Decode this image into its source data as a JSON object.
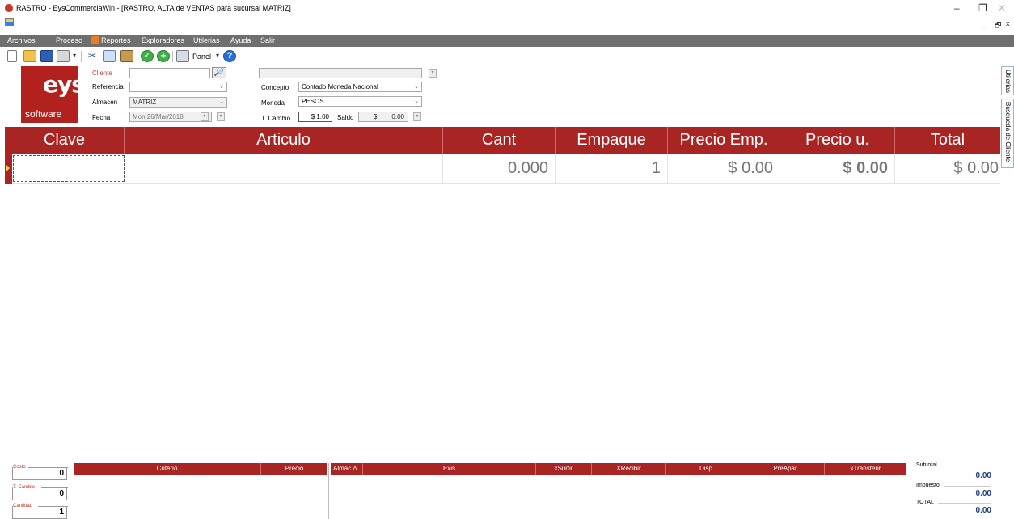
{
  "window": {
    "title": "RASTRO - EysCommerciaWin - [RASTRO, ALTA de VENTAS para sucursal MATRIZ]",
    "minimize": "–",
    "maximize": "❐",
    "close": "✕",
    "mdi_minimize": "_",
    "mdi_restore": "🗗",
    "mdi_close": "x"
  },
  "menu": [
    "Archivos",
    "Proceso",
    "Reportes",
    "Exploradores",
    "Utilerias",
    "Ayuda",
    "Salir"
  ],
  "toolbar": {
    "panel_label": "Panel",
    "caret": "▾"
  },
  "logo": {
    "brand": "eys",
    "sub": "software"
  },
  "form": {
    "cliente_label": "Cliente",
    "cliente_value": "",
    "search_icon": "🔎",
    "cliente_name_value": "",
    "referencia_label": "Referencia",
    "referencia_value": "",
    "almacen_label": "Almacen",
    "almacen_value": "MATRIZ",
    "fecha_label": "Fecha",
    "fecha_value": "Mon 26/Mar/2018",
    "concepto_label": "Concepto",
    "concepto_value": "Contado Moneda Nacional",
    "moneda_label": "Moneda",
    "moneda_value": "PESOS",
    "tcambio_label": "T. Cambio",
    "tcambio_value": "$ 1.00",
    "saldo_label": "Saldo",
    "saldo_currency": "$",
    "saldo_value": "0.00",
    "dropdown_glyph": "⌄"
  },
  "grid": {
    "columns": [
      "Clave",
      "Articulo",
      "Cant",
      "Empaque",
      "Precio Emp.",
      "Precio u.",
      "Total"
    ],
    "rows": [
      {
        "clave": "",
        "articulo": "",
        "cant": "0.000",
        "empaque": "1",
        "precio_emp": "$ 0.00",
        "precio_u": "$ 0.00",
        "total": "$ 0.00"
      }
    ]
  },
  "side_tabs": [
    "Utilerias",
    "Busqueda de Cliente"
  ],
  "bottom": {
    "costo_label": "Costo",
    "costo_value": "0",
    "tcambio_label": "T. Cambio",
    "tcambio_value": "0",
    "cantidad_label": "Cantidad",
    "cantidad_value": "1",
    "criterio_columns": [
      "Criterio",
      "Precio"
    ],
    "almacen_columns": [
      "Almac ∆",
      "Exis",
      "xSurtir",
      "XRecibir",
      "Disp",
      "PreApar",
      "xTransferir"
    ],
    "subtotal_label": "Subtotal",
    "subtotal_value": "0.00",
    "impuesto_label": "Impuesto",
    "impuesto_value": "0.00",
    "total_label": "TOTAL",
    "total_value": "0.00"
  },
  "colors": {
    "accent": "#a92524",
    "menubar": "#6f6f6f"
  }
}
